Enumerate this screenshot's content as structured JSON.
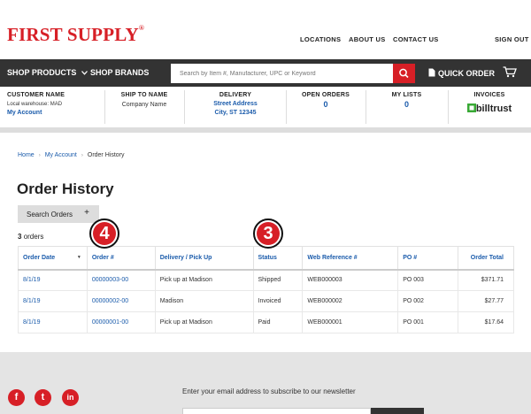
{
  "header": {
    "logo": "FIRST SUPPLY",
    "logo_mark": "®",
    "links": [
      "LOCATIONS",
      "ABOUT US",
      "CONTACT US",
      "SIGN OUT"
    ]
  },
  "nav": {
    "shop_products": "SHOP PRODUCTS",
    "shop_brands": "SHOP BRANDS",
    "search_placeholder": "Search by Item #, Manufacturer, UPC or Keyword",
    "quick_order": "QUICK ORDER"
  },
  "account": {
    "customer_name_label": "CUSTOMER NAME",
    "local_warehouse": "Local warehouse: MAD",
    "my_account": "My Account",
    "ship_to_label": "SHIP TO NAME",
    "company_name": "Company Name",
    "delivery_label": "DELIVERY",
    "street": "Street Address",
    "city": "City, ST 12345",
    "open_orders_label": "OPEN ORDERS",
    "open_orders_count": "0",
    "my_lists_label": "MY LISTS",
    "my_lists_count": "0",
    "invoices_label": "INVOICES",
    "billtrust": "billtrust"
  },
  "breadcrumb": [
    "Home",
    "My Account",
    "Order History"
  ],
  "page": {
    "title": "Order History",
    "search_orders": "Search Orders",
    "plus": "+",
    "count_num": "3",
    "count_label": "orders"
  },
  "table": {
    "headers": [
      "Order Date",
      "Order #",
      "Delivery / Pick Up",
      "Status",
      "Web Reference #",
      "PO #",
      "Order Total"
    ],
    "rows": [
      [
        "8/1/19",
        "00000003-00",
        "Pick up at Madison",
        "Shipped",
        "WEB000003",
        "PO 003",
        "$371.71"
      ],
      [
        "8/1/19",
        "00000002-00",
        "Madison",
        "Invoiced",
        "WEB000002",
        "PO 002",
        "$27.77"
      ],
      [
        "8/1/19",
        "00000001-00",
        "Pick up at Madison",
        "Paid",
        "WEB000001",
        "PO 001",
        "$17.64"
      ]
    ]
  },
  "markers": [
    "4",
    "3"
  ],
  "footer": {
    "newsletter": "Enter your email address to subscribe to our newsletter",
    "social": [
      "f",
      "t",
      "in"
    ]
  },
  "colors": {
    "brand_red": "#d71f26",
    "link_blue": "#1a5bab",
    "nav_dark": "#333333"
  }
}
